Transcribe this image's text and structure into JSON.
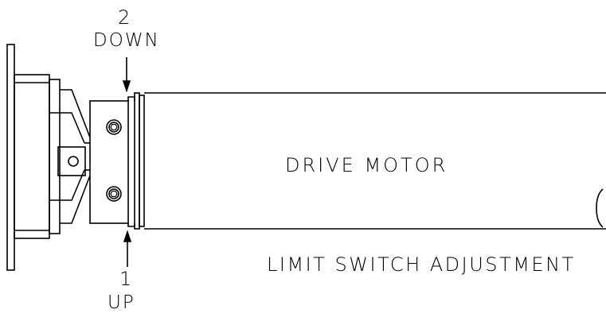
{
  "diagram": {
    "down_arrow": {
      "number": "2",
      "label": "DOWN"
    },
    "up_arrow": {
      "number": "1",
      "label": "UP"
    },
    "motor_label": "DRIVE MOTOR",
    "caption": "LIMIT SWITCH ADJUSTMENT"
  },
  "colors": {
    "line": "#000000",
    "background": "#ffffff"
  }
}
